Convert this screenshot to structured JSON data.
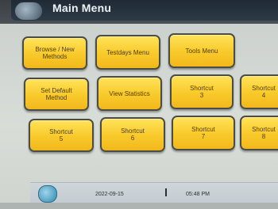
{
  "header": {
    "title": "Main Menu"
  },
  "tiles": [
    {
      "label": "Browse / New\nMethods"
    },
    {
      "label": "Testdays Menu"
    },
    {
      "label": "Tools Menu"
    },
    {
      "label": "Set Default\nMethod"
    },
    {
      "label": "View Statistics"
    },
    {
      "label": "Shortcut\n3"
    },
    {
      "label": "Shortcut\n4"
    },
    {
      "label": "Shortcut\n5"
    },
    {
      "label": "Shortcut\n6"
    },
    {
      "label": "Shortcut\n7"
    },
    {
      "label": "Shortcut\n8"
    }
  ],
  "status": {
    "date": "2022-09-15",
    "time": "05:48 PM"
  },
  "icons": {
    "home": "home-icon",
    "status": "status-icon"
  },
  "colors": {
    "tile_fill": "#f8c92a",
    "tile_border": "#4b4d44",
    "title_bar": "#2d3b48"
  }
}
